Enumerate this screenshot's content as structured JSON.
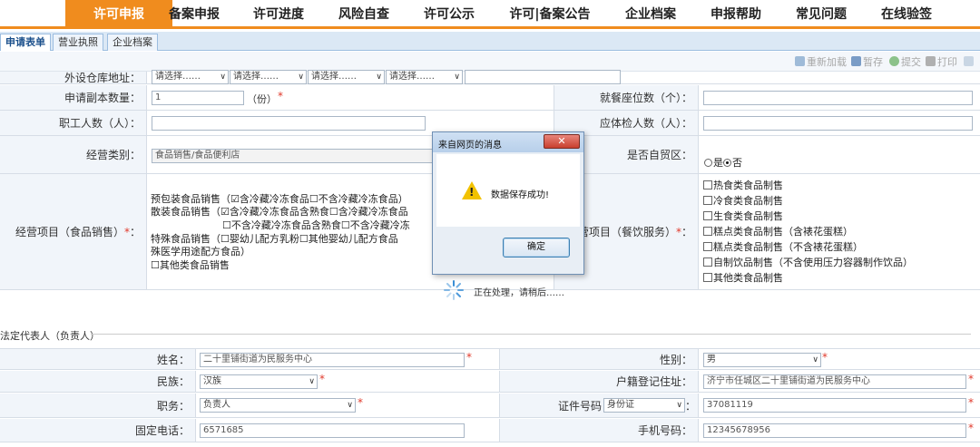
{
  "nav": [
    "许可申报",
    "备案申报",
    "许可进度",
    "风险自查",
    "许可公示",
    "许可|备案公告",
    "企业档案",
    "申报帮助",
    "常见问题",
    "在线验签"
  ],
  "subtabs": [
    "申请表单",
    "营业执照",
    "企业档案"
  ],
  "toolbar": {
    "reload": "重新加载",
    "draft": "暂存",
    "submit": "提交",
    "print": "打印"
  },
  "form": {
    "warehouse_label": "外设仓库地址：",
    "warehouse_selects": [
      "请选择……",
      "请选择……",
      "请选择……",
      "请选择……"
    ],
    "copies_label": "申请副本数量：",
    "copies_value": "1",
    "copies_unit": "（份）",
    "seats_label": "就餐座位数（个）：",
    "staff_label": "职工人数（人）：",
    "exam_label": "应体检人数（人）：",
    "category_label": "经营类别：",
    "category_value": "食品销售/食品便利店",
    "ftz_label": "是否自贸区：",
    "ftz_options": [
      "是",
      "否"
    ],
    "sales_label": "经营项目（食品销售）",
    "sales_lines": [
      "预包装食品销售（☑含冷藏冷冻食品☐不含冷藏冷冻食品）",
      "散装食品销售（☑含冷藏冷冻食品含熟食☐含冷藏冷冻食品",
      "☐不含冷藏冷冻食品含熟食☐不含冷藏冷冻",
      "特殊食品销售（☐婴幼儿配方乳粉☐其他婴幼儿配方食品",
      "殊医学用途配方食品）",
      "☐其他类食品销售"
    ],
    "catering_label": "营项目（餐饮服务）",
    "catering_items": [
      "热食类食品制售",
      "冷食类食品制售",
      "生食类食品制售",
      "糕点类食品制售（含裱花蛋糕）",
      "糕点类食品制售（不含裱花蛋糕）",
      "自制饮品制售（不含使用压力容器制作饮品）",
      "其他类食品制售"
    ]
  },
  "section": {
    "title": "法定代表人（负责人）"
  },
  "person": {
    "name_label": "姓名：",
    "name_value": "二十里铺街道为民服务中心",
    "gender_label": "性别：",
    "gender_value": "男",
    "ethnic_label": "民族：",
    "ethnic_value": "汉族",
    "address_label": "户籍登记住址：",
    "address_value": "济宁市任城区二十里铺街道为民服务中心",
    "position_label": "职务：",
    "position_value": "负责人",
    "idtype_label": "证件号码",
    "idtype_value": "身份证",
    "id_value": "37081119",
    "phone_label": "固定电话：",
    "phone_value": "6571685",
    "mobile_label": "手机号码：",
    "mobile_value": "12345678956"
  },
  "dialog": {
    "title": "来自网页的消息",
    "message": "数据保存成功!",
    "ok": "确定",
    "close": "✕"
  },
  "processing": "正在处理，请稍后……",
  "colors": {
    "accent": "#f08c1e",
    "required": "#e0392b"
  }
}
